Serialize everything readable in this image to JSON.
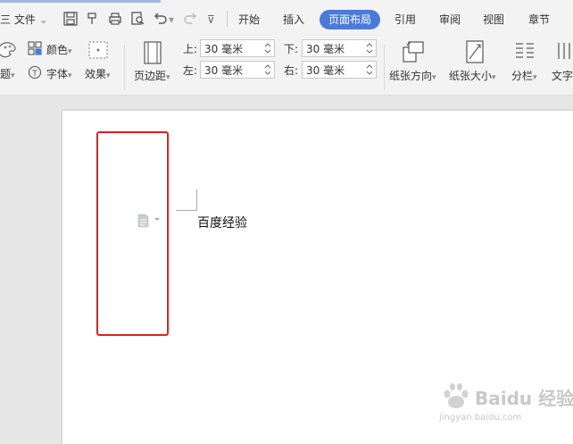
{
  "menu": {
    "file_label": "文件",
    "file_prefix": "三"
  },
  "tabs": [
    {
      "label": "开始"
    },
    {
      "label": "插入"
    },
    {
      "label": "页面布局"
    },
    {
      "label": "引用"
    },
    {
      "label": "审阅"
    },
    {
      "label": "视图"
    },
    {
      "label": "章节"
    }
  ],
  "active_tab": "页面布局",
  "ribbon": {
    "theme_label": "题",
    "color_label": "颜色",
    "font_label": "字体",
    "effect_label": "效果",
    "margin_label": "页边距",
    "top_label": "上:",
    "bottom_label": "下:",
    "left_label": "左:",
    "right_label": "右:",
    "top_value": "30 毫米",
    "bottom_value": "30 毫米",
    "left_value": "30 毫米",
    "right_value": "30 毫米",
    "orientation_label": "纸张方向",
    "size_label": "纸张大小",
    "columns_label": "分栏",
    "text_label": "文字"
  },
  "document": {
    "text": "百度经验"
  },
  "watermark": {
    "brand": "Baidu 经验",
    "url": "jingyan.baidu.com"
  },
  "colors": {
    "accent": "#4b7bd8",
    "highlight_box": "#e02020"
  }
}
